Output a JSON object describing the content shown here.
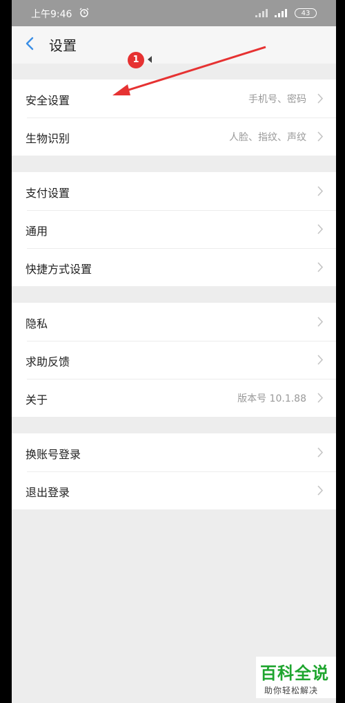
{
  "status_bar": {
    "time": "上午9:46",
    "battery": "43"
  },
  "header": {
    "title": "设置"
  },
  "annotation": {
    "badge": "1"
  },
  "groups": [
    {
      "items": [
        {
          "label": "安全设置",
          "value": "手机号、密码"
        },
        {
          "label": "生物识别",
          "value": "人脸、指纹、声纹"
        }
      ]
    },
    {
      "items": [
        {
          "label": "支付设置",
          "value": ""
        },
        {
          "label": "通用",
          "value": ""
        },
        {
          "label": "快捷方式设置",
          "value": ""
        }
      ]
    },
    {
      "items": [
        {
          "label": "隐私",
          "value": ""
        },
        {
          "label": "求助反馈",
          "value": ""
        },
        {
          "label": "关于",
          "value": "版本号 10.1.88"
        }
      ]
    },
    {
      "items": [
        {
          "label": "换账号登录",
          "value": ""
        },
        {
          "label": "退出登录",
          "value": ""
        }
      ]
    }
  ],
  "watermark": {
    "title": "百科全说",
    "subtitle": "助你轻松解决"
  },
  "colors": {
    "accent": "#3a8ee6",
    "annotation_red": "#e63232",
    "watermark_green": "#1ea52e"
  }
}
